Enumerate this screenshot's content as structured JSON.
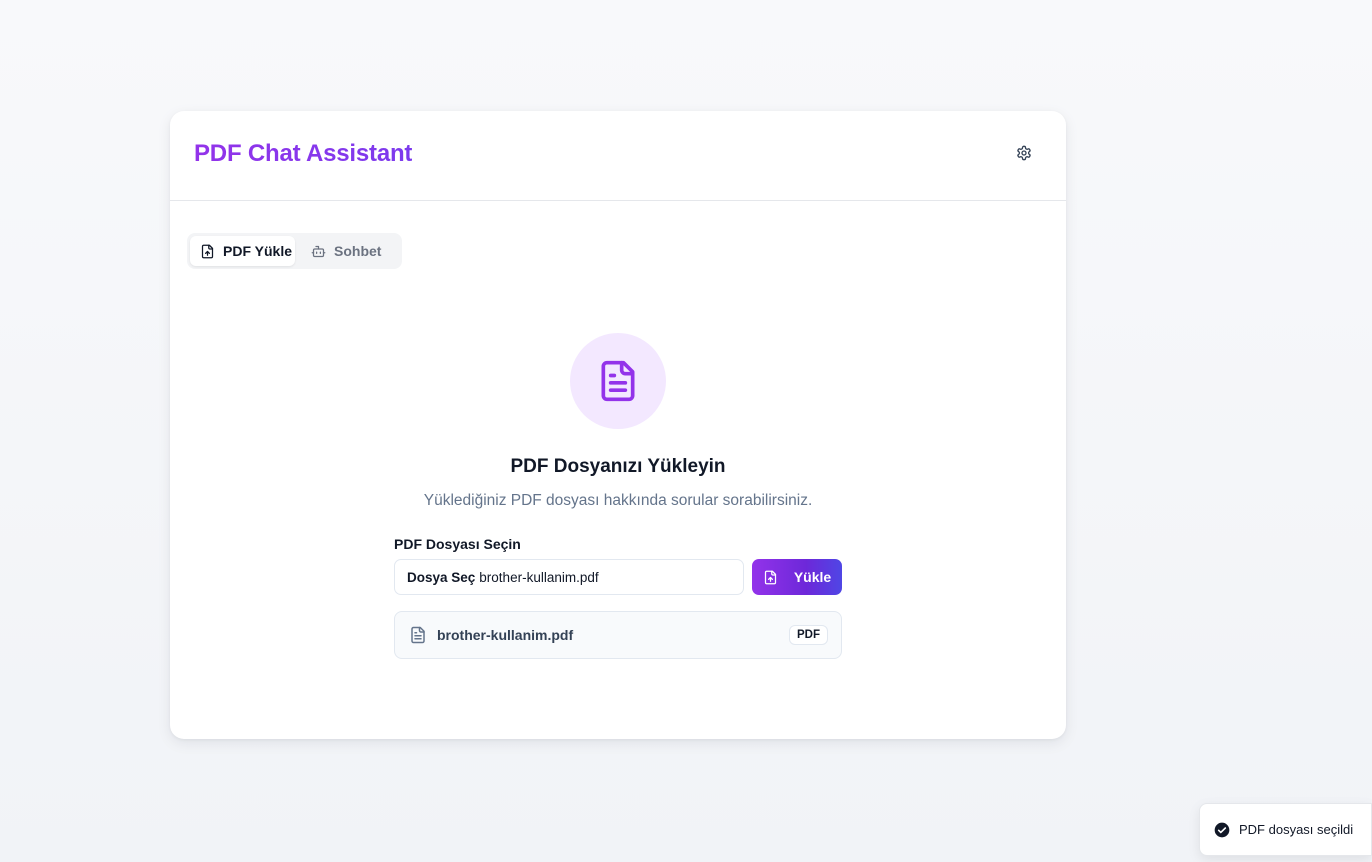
{
  "app": {
    "title": "PDF Chat Assistant",
    "settings_icon": "gear-icon",
    "accent_color": "#9333ea",
    "accent_gradient_end": "#4f46e5"
  },
  "tabs": [
    {
      "label": "PDF Yükle",
      "icon": "file-upload-icon",
      "active": true
    },
    {
      "label": "Sohbet",
      "icon": "bot-icon",
      "active": false
    }
  ],
  "upload": {
    "hero_icon": "file-text-icon",
    "heading": "PDF Dosyanızı Yükleyin",
    "subheading": "Yüklediğiniz PDF dosyası hakkında sorular sorabilirsiniz.",
    "field_label": "PDF Dosyası Seçin",
    "choose_label": "Dosya Seç",
    "selected_file": "brother-kullanim.pdf",
    "button_label": "Yükle",
    "button_icon": "file-upload-icon"
  },
  "selected_file": {
    "name": "brother-kullanim.pdf",
    "badge": "PDF",
    "icon": "file-text-icon"
  },
  "toast": {
    "message": "PDF dosyası seçildi",
    "icon": "check-circle-icon"
  }
}
